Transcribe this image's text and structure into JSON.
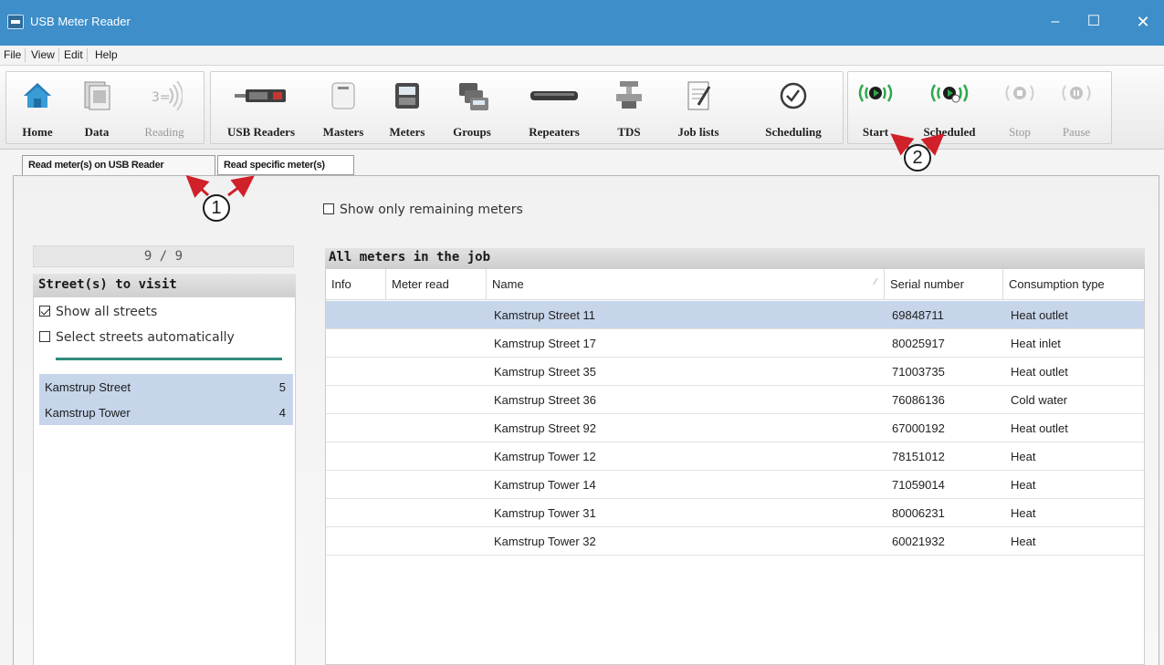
{
  "window": {
    "title": "USB Meter Reader",
    "controls": {
      "minimize": "–",
      "maximize": "☐",
      "close": "✕"
    }
  },
  "menu": [
    "File",
    "View",
    "Edit",
    "Help"
  ],
  "toolbar": {
    "nav": [
      {
        "label": "Home",
        "icon": "home-icon"
      },
      {
        "label": "Data",
        "icon": "data-icon"
      },
      {
        "label": "Reading",
        "icon": "reading-icon",
        "disabled": true
      }
    ],
    "modules": [
      {
        "label": "USB Readers",
        "icon": "usb-reader-icon"
      },
      {
        "label": "Masters",
        "icon": "masters-icon"
      },
      {
        "label": "Meters",
        "icon": "meters-icon"
      },
      {
        "label": "Groups",
        "icon": "groups-icon"
      },
      {
        "label": "Repeaters",
        "icon": "repeaters-icon"
      },
      {
        "label": "TDS",
        "icon": "tds-icon"
      },
      {
        "label": "Job lists",
        "icon": "job-lists-icon"
      },
      {
        "label": "Scheduling",
        "icon": "clock-icon"
      }
    ],
    "actions": [
      {
        "label": "Start",
        "icon": "start-icon"
      },
      {
        "label": "Scheduled",
        "icon": "scheduled-icon"
      },
      {
        "label": "Stop",
        "icon": "stop-icon",
        "disabled": true
      },
      {
        "label": "Pause",
        "icon": "pause-icon",
        "disabled": true
      }
    ]
  },
  "tabs": [
    {
      "label": "Read meter(s) on USB Reader",
      "active": true
    },
    {
      "label": "Read specific meter(s)",
      "active": false
    }
  ],
  "callouts": {
    "one": "1",
    "two": "2"
  },
  "left_panel": {
    "counter": "9 / 9",
    "header": "Street(s) to visit",
    "show_all_streets": {
      "label": "Show all streets",
      "checked": true
    },
    "select_auto": {
      "label": "Select streets automatically",
      "checked": false
    },
    "streets": [
      {
        "name": "Kamstrup Street",
        "count": "5"
      },
      {
        "name": "Kamstrup Tower",
        "count": "4"
      }
    ]
  },
  "show_remaining": {
    "label": "Show only remaining meters",
    "checked": false
  },
  "grid": {
    "title": "All meters in the job",
    "columns": [
      "Info",
      "Meter read",
      "Name",
      "Serial number",
      "Consumption type"
    ],
    "rows": [
      {
        "info": "",
        "read": "",
        "name": "Kamstrup Street 11",
        "serial": "69848711",
        "type": "Heat outlet",
        "selected": true
      },
      {
        "info": "",
        "read": "",
        "name": "Kamstrup Street 17",
        "serial": "80025917",
        "type": "Heat inlet"
      },
      {
        "info": "",
        "read": "",
        "name": "Kamstrup Street 35",
        "serial": "71003735",
        "type": "Heat outlet"
      },
      {
        "info": "",
        "read": "",
        "name": "Kamstrup Street 36",
        "serial": "76086136",
        "type": "Cold water"
      },
      {
        "info": "",
        "read": "",
        "name": "Kamstrup Street 92",
        "serial": "67000192",
        "type": "Heat outlet"
      },
      {
        "info": "",
        "read": "",
        "name": "Kamstrup Tower 12",
        "serial": "78151012",
        "type": "Heat"
      },
      {
        "info": "",
        "read": "",
        "name": "Kamstrup Tower 14",
        "serial": "71059014",
        "type": "Heat"
      },
      {
        "info": "",
        "read": "",
        "name": "Kamstrup Tower 31",
        "serial": "80006231",
        "type": "Heat"
      },
      {
        "info": "",
        "read": "",
        "name": "Kamstrup Tower 32",
        "serial": "60021932",
        "type": "Heat"
      }
    ]
  },
  "colors": {
    "titlebar": "#3d8ec9",
    "selection": "#c6d5ea",
    "accent_green": "#2fa84a",
    "callout_arrow": "#d0202a"
  }
}
